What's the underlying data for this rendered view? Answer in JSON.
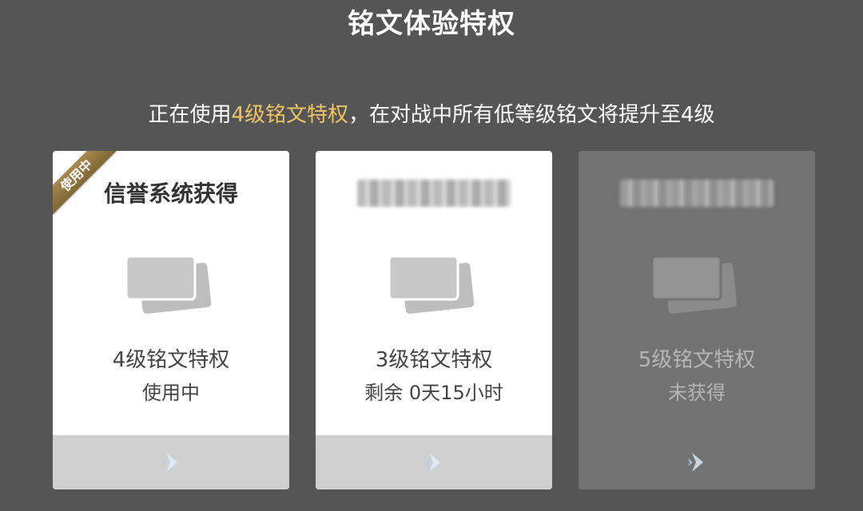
{
  "header": {
    "title": "铭文体验特权"
  },
  "subtitle": {
    "prefix": "正在使用",
    "highlight": "4级铭文特权",
    "suffix": "，在对战中所有低等级铭文将提升至4级",
    "highlight_color": "#f0c463"
  },
  "cards": [
    {
      "title": "信誉系统获得",
      "badge": "使用中",
      "level_label": "4级铭文特权",
      "status": "使用中",
      "state": "active",
      "icon": "inscription-cards-icon",
      "footer_icon": "arrow-right-icon"
    },
    {
      "title_blurred": true,
      "level_label": "3级铭文特权",
      "status": "剩余 0天15小时",
      "state": "available",
      "icon": "inscription-cards-icon",
      "footer_icon": "arrow-right-icon"
    },
    {
      "title_blurred": true,
      "level_label": "5级铭文特权",
      "status": "未获得",
      "state": "locked",
      "icon": "inscription-cards-icon",
      "footer_icon": "arrow-right-icon"
    }
  ],
  "colors": {
    "background": "#555555",
    "card_active": "#ffffff",
    "card_locked": "#727272",
    "footer_active": "#cfcfcf",
    "badge": "#8f7540",
    "arrow": "#cfe0f2"
  }
}
